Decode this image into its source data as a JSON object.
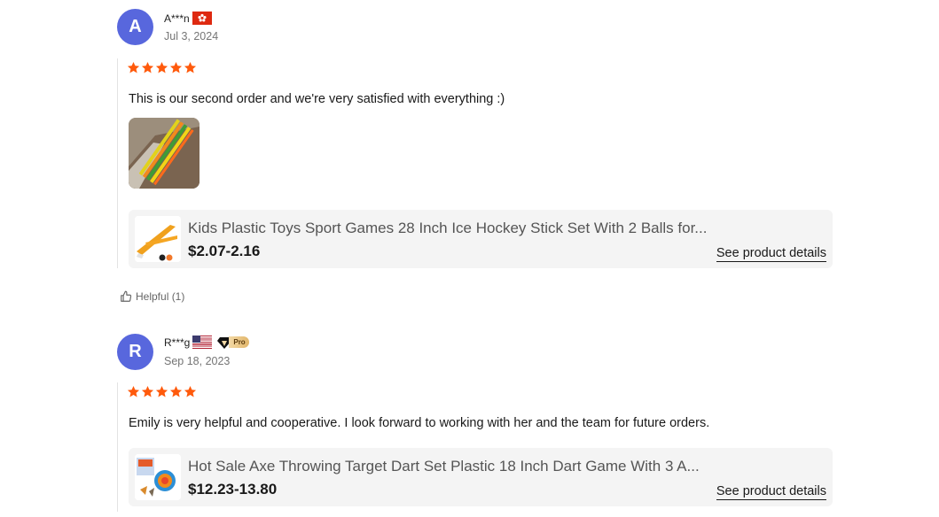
{
  "reviews": [
    {
      "avatar_letter": "A",
      "username": "A***n",
      "flag": "hong-kong-flag",
      "date": "Jul 3, 2024",
      "rating": 5,
      "text": "This is our second order and we're very satisfied with everything :)",
      "has_photo": true,
      "product": {
        "title": "Kids Plastic Toys Sport Games 28 Inch Ice Hockey Stick Set With 2 Balls for...",
        "price": "$2.07-2.16",
        "link_label": "See product details"
      },
      "helpful_label": "Helpful (1)"
    },
    {
      "avatar_letter": "R",
      "username": "R***g",
      "flag": "usa-flag",
      "badge": "Pro",
      "date": "Sep 18, 2023",
      "rating": 5,
      "text": "Emily is very helpful and cooperative. I look forward to working with her and the team for future orders.",
      "product": {
        "title": "Hot Sale Axe Throwing Target Dart Set Plastic 18 Inch Dart Game With 3 A...",
        "price": "$12.23-13.80",
        "link_label": "See product details"
      }
    }
  ],
  "colors": {
    "avatar": "#5867dd",
    "star": "#ff5a0c",
    "card_bg": "#f4f4f4"
  }
}
